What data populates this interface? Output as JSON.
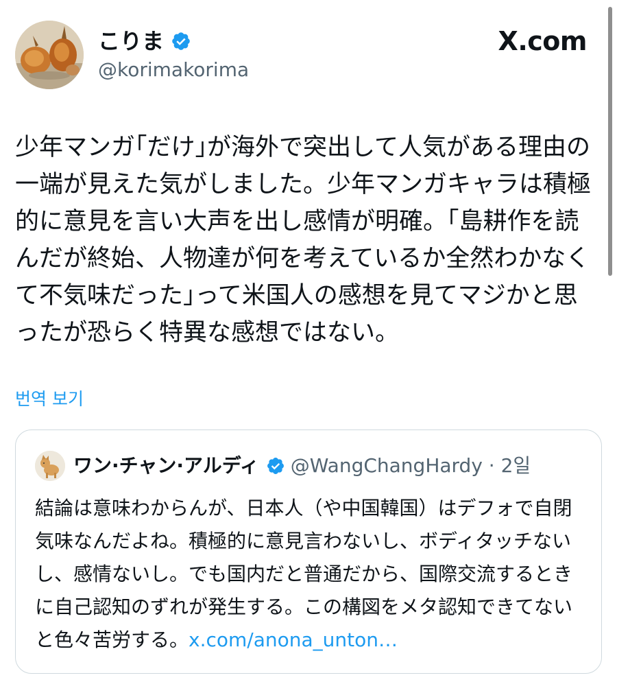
{
  "author": {
    "display_name": "こりま",
    "handle": "@korimakorima",
    "avatar": "onion-painting-avatar",
    "verified_icon": "verified-badge-icon"
  },
  "site": {
    "logo_text": "X.com"
  },
  "tweet": {
    "text": "少年マンガ｢だけ｣が海外で突出して人気がある理由の一端が見えた気がしました。少年マンガキャラは積極的に意見を言い大声を出し感情が明確。｢島耕作を読んだが終始、人物達が何を考えているか全然わかなくて不気味だった｣って米国人の感想を見てマジかと思ったが恐らく特異な感想ではない。",
    "translate_label": "번역 보기"
  },
  "quote": {
    "display_name": "ワン·チャン·アルディ",
    "handle_time": "@WangChangHardy · 2일",
    "avatar": "shiba-dog-avatar",
    "text": "結論は意味わからんが、日本人（や中国韓国）はデフォで自閉気味なんだよね。積極的に意見言わないし、ボディタッチないし、感情ないし。でも国内だと普通だから、国際交流するときに自己認知のずれが発生する。この構図をメタ認知できてないと色々苦労する。",
    "link_text": "x.com/anona_unton…"
  },
  "colors": {
    "text": "#0f1419",
    "secondary": "#536471",
    "link": "#1d9bf0",
    "verified": "#1d9bf0",
    "border": "#cfd9de"
  }
}
